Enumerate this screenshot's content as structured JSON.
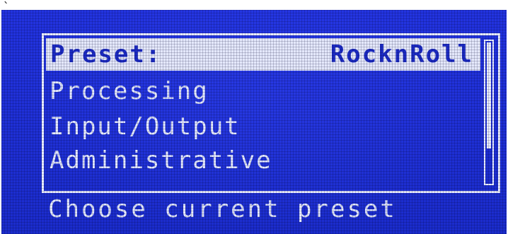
{
  "stray_mark": "`",
  "menu": {
    "selected_row": {
      "label": "Preset:",
      "value": "RocknRoll"
    },
    "items": [
      "Processing",
      "Input/Output",
      "Administrative"
    ],
    "scroll_position_fraction": 0.0
  },
  "hint_text": "Choose current preset",
  "colors": {
    "lcd_background": "#1f2fd6",
    "lcd_text": "#e6ebff",
    "highlight_background": "#e4e8fb",
    "highlight_text": "#1c2bc4"
  }
}
